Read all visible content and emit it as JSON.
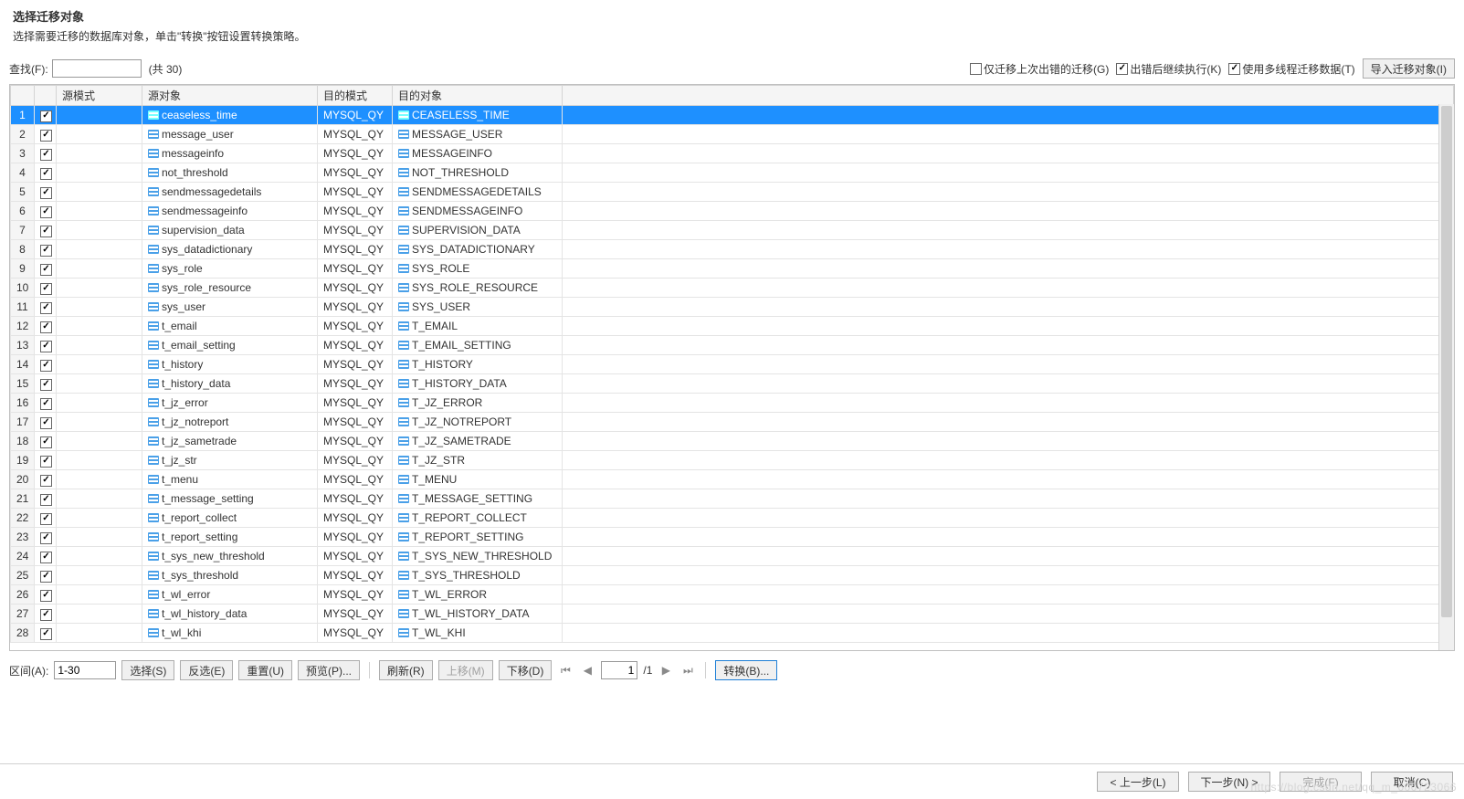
{
  "header": {
    "title": "选择迁移对象",
    "subtitle": "选择需要迁移的数据库对象，单击\"转换\"按钮设置转换策略。"
  },
  "toolbar": {
    "find_label": "查找(F):",
    "find_value": "",
    "count_label": "(共 30)",
    "cb_only_failed": {
      "label": "仅迁移上次出错的迁移(G)",
      "checked": false
    },
    "cb_continue": {
      "label": "出错后继续执行(K)",
      "checked": true
    },
    "cb_multithread": {
      "label": "使用多线程迁移数据(T)",
      "checked": true
    },
    "import_label": "导入迁移对象(I)"
  },
  "grid": {
    "headers": {
      "src_schema": "源模式",
      "src_obj": "源对象",
      "dst_schema": "目的模式",
      "dst_obj": "目的对象"
    },
    "rows": [
      {
        "n": 1,
        "checked": true,
        "src_obj": "ceaseless_time",
        "dst_schema": "MYSQL_QY",
        "dst_obj": "CEASELESS_TIME",
        "selected": true
      },
      {
        "n": 2,
        "checked": true,
        "src_obj": "message_user",
        "dst_schema": "MYSQL_QY",
        "dst_obj": "MESSAGE_USER"
      },
      {
        "n": 3,
        "checked": true,
        "src_obj": "messageinfo",
        "dst_schema": "MYSQL_QY",
        "dst_obj": "MESSAGEINFO"
      },
      {
        "n": 4,
        "checked": true,
        "src_obj": "not_threshold",
        "dst_schema": "MYSQL_QY",
        "dst_obj": "NOT_THRESHOLD"
      },
      {
        "n": 5,
        "checked": true,
        "src_obj": "sendmessagedetails",
        "dst_schema": "MYSQL_QY",
        "dst_obj": "SENDMESSAGEDETAILS"
      },
      {
        "n": 6,
        "checked": true,
        "src_obj": "sendmessageinfo",
        "dst_schema": "MYSQL_QY",
        "dst_obj": "SENDMESSAGEINFO"
      },
      {
        "n": 7,
        "checked": true,
        "src_obj": "supervision_data",
        "dst_schema": "MYSQL_QY",
        "dst_obj": "SUPERVISION_DATA"
      },
      {
        "n": 8,
        "checked": true,
        "src_obj": "sys_datadictionary",
        "dst_schema": "MYSQL_QY",
        "dst_obj": "SYS_DATADICTIONARY"
      },
      {
        "n": 9,
        "checked": true,
        "src_obj": "sys_role",
        "dst_schema": "MYSQL_QY",
        "dst_obj": "SYS_ROLE"
      },
      {
        "n": 10,
        "checked": true,
        "src_obj": "sys_role_resource",
        "dst_schema": "MYSQL_QY",
        "dst_obj": "SYS_ROLE_RESOURCE"
      },
      {
        "n": 11,
        "checked": true,
        "src_obj": "sys_user",
        "dst_schema": "MYSQL_QY",
        "dst_obj": "SYS_USER"
      },
      {
        "n": 12,
        "checked": true,
        "src_obj": "t_email",
        "dst_schema": "MYSQL_QY",
        "dst_obj": "T_EMAIL"
      },
      {
        "n": 13,
        "checked": true,
        "src_obj": "t_email_setting",
        "dst_schema": "MYSQL_QY",
        "dst_obj": "T_EMAIL_SETTING"
      },
      {
        "n": 14,
        "checked": true,
        "src_obj": "t_history",
        "dst_schema": "MYSQL_QY",
        "dst_obj": "T_HISTORY"
      },
      {
        "n": 15,
        "checked": true,
        "src_obj": "t_history_data",
        "dst_schema": "MYSQL_QY",
        "dst_obj": "T_HISTORY_DATA"
      },
      {
        "n": 16,
        "checked": true,
        "src_obj": "t_jz_error",
        "dst_schema": "MYSQL_QY",
        "dst_obj": "T_JZ_ERROR"
      },
      {
        "n": 17,
        "checked": true,
        "src_obj": "t_jz_notreport",
        "dst_schema": "MYSQL_QY",
        "dst_obj": "T_JZ_NOTREPORT"
      },
      {
        "n": 18,
        "checked": true,
        "src_obj": "t_jz_sametrade",
        "dst_schema": "MYSQL_QY",
        "dst_obj": "T_JZ_SAMETRADE"
      },
      {
        "n": 19,
        "checked": true,
        "src_obj": "t_jz_str",
        "dst_schema": "MYSQL_QY",
        "dst_obj": "T_JZ_STR"
      },
      {
        "n": 20,
        "checked": true,
        "src_obj": "t_menu",
        "dst_schema": "MYSQL_QY",
        "dst_obj": "T_MENU"
      },
      {
        "n": 21,
        "checked": true,
        "src_obj": "t_message_setting",
        "dst_schema": "MYSQL_QY",
        "dst_obj": "T_MESSAGE_SETTING"
      },
      {
        "n": 22,
        "checked": true,
        "src_obj": "t_report_collect",
        "dst_schema": "MYSQL_QY",
        "dst_obj": "T_REPORT_COLLECT"
      },
      {
        "n": 23,
        "checked": true,
        "src_obj": "t_report_setting",
        "dst_schema": "MYSQL_QY",
        "dst_obj": "T_REPORT_SETTING"
      },
      {
        "n": 24,
        "checked": true,
        "src_obj": "t_sys_new_threshold",
        "dst_schema": "MYSQL_QY",
        "dst_obj": "T_SYS_NEW_THRESHOLD"
      },
      {
        "n": 25,
        "checked": true,
        "src_obj": "t_sys_threshold",
        "dst_schema": "MYSQL_QY",
        "dst_obj": "T_SYS_THRESHOLD"
      },
      {
        "n": 26,
        "checked": true,
        "src_obj": "t_wl_error",
        "dst_schema": "MYSQL_QY",
        "dst_obj": "T_WL_ERROR"
      },
      {
        "n": 27,
        "checked": true,
        "src_obj": "t_wl_history_data",
        "dst_schema": "MYSQL_QY",
        "dst_obj": "T_WL_HISTORY_DATA"
      },
      {
        "n": 28,
        "checked": true,
        "src_obj": "t_wl_khi",
        "dst_schema": "MYSQL_QY",
        "dst_obj": "T_WL_KHI"
      }
    ]
  },
  "bottom": {
    "range_label": "区间(A):",
    "range_value": "1-30",
    "select_label": "选择(S)",
    "invert_label": "反选(E)",
    "reset_label": "重置(U)",
    "preview_label": "预览(P)...",
    "refresh_label": "刷新(R)",
    "moveup_label": "上移(M)",
    "movedown_label": "下移(D)",
    "page_value": "1",
    "page_total": "/1",
    "convert_label": "转换(B)..."
  },
  "footer": {
    "prev_label": "< 上一步(L)",
    "next_label": "下一步(N) >",
    "finish_label": "完成(F)",
    "cancel_label": "取消(C)"
  },
  "watermark": "https://blog.csdn.net/qq_m_600723066"
}
